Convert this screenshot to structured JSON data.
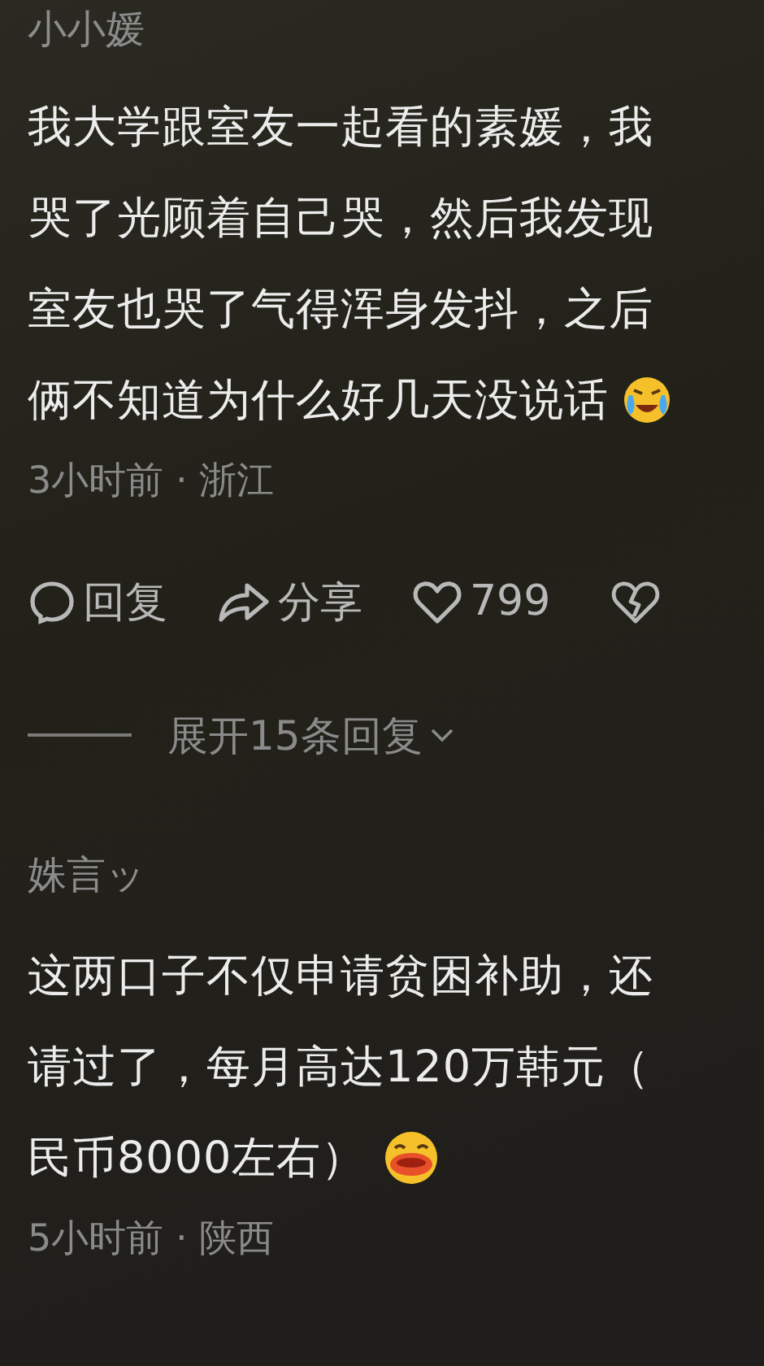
{
  "comments": [
    {
      "author": "小小媛",
      "lines": [
        "我大学跟室友一起看的素媛，我",
        "哭了光顾着自己哭，然后我发现",
        "室友也哭了气得浑身发抖，之后",
        "俩不知道为什么好几天没说话"
      ],
      "emoji": {
        "kind": "crying"
      },
      "meta": "3小时前 · 浙江",
      "actions": {
        "reply": "回复",
        "share": "分享",
        "likes": "799"
      },
      "expand": "展开15条回复"
    },
    {
      "author": "姝言ッ",
      "lines": [
        "这两口子不仅申请贫困补助，还",
        "请过了，每月高达120万韩元（",
        "民币8000左右）"
      ],
      "emoji": {
        "kind": "laughing"
      },
      "meta": "5小时前 · 陕西"
    }
  ]
}
